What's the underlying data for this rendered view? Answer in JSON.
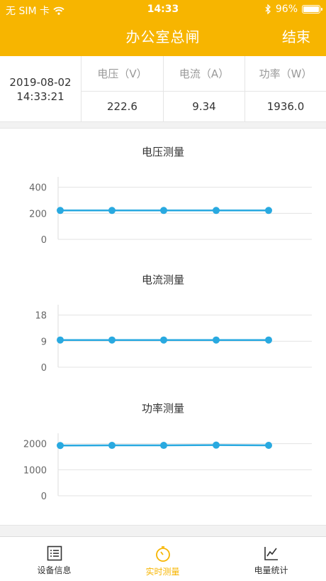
{
  "status_bar": {
    "carrier": "无 SIM 卡",
    "time": "14:33",
    "battery": "96%",
    "icons": [
      "wifi-icon",
      "bluetooth-icon",
      "battery-icon"
    ]
  },
  "header": {
    "title": "办公室总闸",
    "action": "结束"
  },
  "info": {
    "date": "2019-08-02",
    "time": "14:33:21",
    "columns": [
      {
        "label": "电压（V）",
        "value": "222.6"
      },
      {
        "label": "电流（A）",
        "value": "9.34"
      },
      {
        "label": "功率（W）",
        "value": "1936.0"
      }
    ]
  },
  "chart_data": [
    {
      "type": "line",
      "title": "电压测量",
      "ticks": [
        "0",
        "200",
        "400"
      ],
      "ylim": [
        0,
        480
      ],
      "series": [
        {
          "values": [
            222,
            222,
            222,
            222,
            222
          ]
        }
      ],
      "color": "#29a9e0",
      "grid": true
    },
    {
      "type": "line",
      "title": "电流测量",
      "ticks": [
        "0",
        "9",
        "18"
      ],
      "ylim": [
        0,
        21.6
      ],
      "series": [
        {
          "values": [
            9.4,
            9.4,
            9.4,
            9.4,
            9.4
          ]
        }
      ],
      "color": "#29a9e0",
      "grid": true
    },
    {
      "type": "line",
      "title": "功率测量",
      "ticks": [
        "0",
        "1000",
        "2000"
      ],
      "ylim": [
        0,
        2400
      ],
      "series": [
        {
          "values": [
            1930,
            1935,
            1935,
            1945,
            1936
          ]
        }
      ],
      "color": "#29a9e0",
      "grid": true
    }
  ],
  "tabs": [
    {
      "label": "设备信息",
      "icon": "list-icon",
      "active": false
    },
    {
      "label": "实时测量",
      "icon": "stopwatch-icon",
      "active": true
    },
    {
      "label": "电量统计",
      "icon": "line-chart-icon",
      "active": false
    }
  ],
  "colors": {
    "accent": "#f7b500",
    "series": "#29a9e0"
  }
}
